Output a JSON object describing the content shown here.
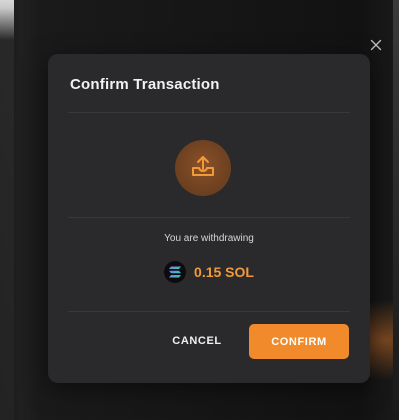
{
  "modal": {
    "title": "Confirm Transaction",
    "message": "You are withdrawing",
    "amount": "0.15 SOL",
    "token_icon": "solana-icon",
    "status_icon": "withdraw-tray-icon"
  },
  "buttons": {
    "cancel_label": "CANCEL",
    "confirm_label": "CONFIRM"
  },
  "close_icon": "close-icon",
  "colors": {
    "accent": "#f08a2a",
    "amount": "#f29a3a",
    "modal_bg": "#2a2a2c",
    "icon_circle": "#6b3f20"
  }
}
